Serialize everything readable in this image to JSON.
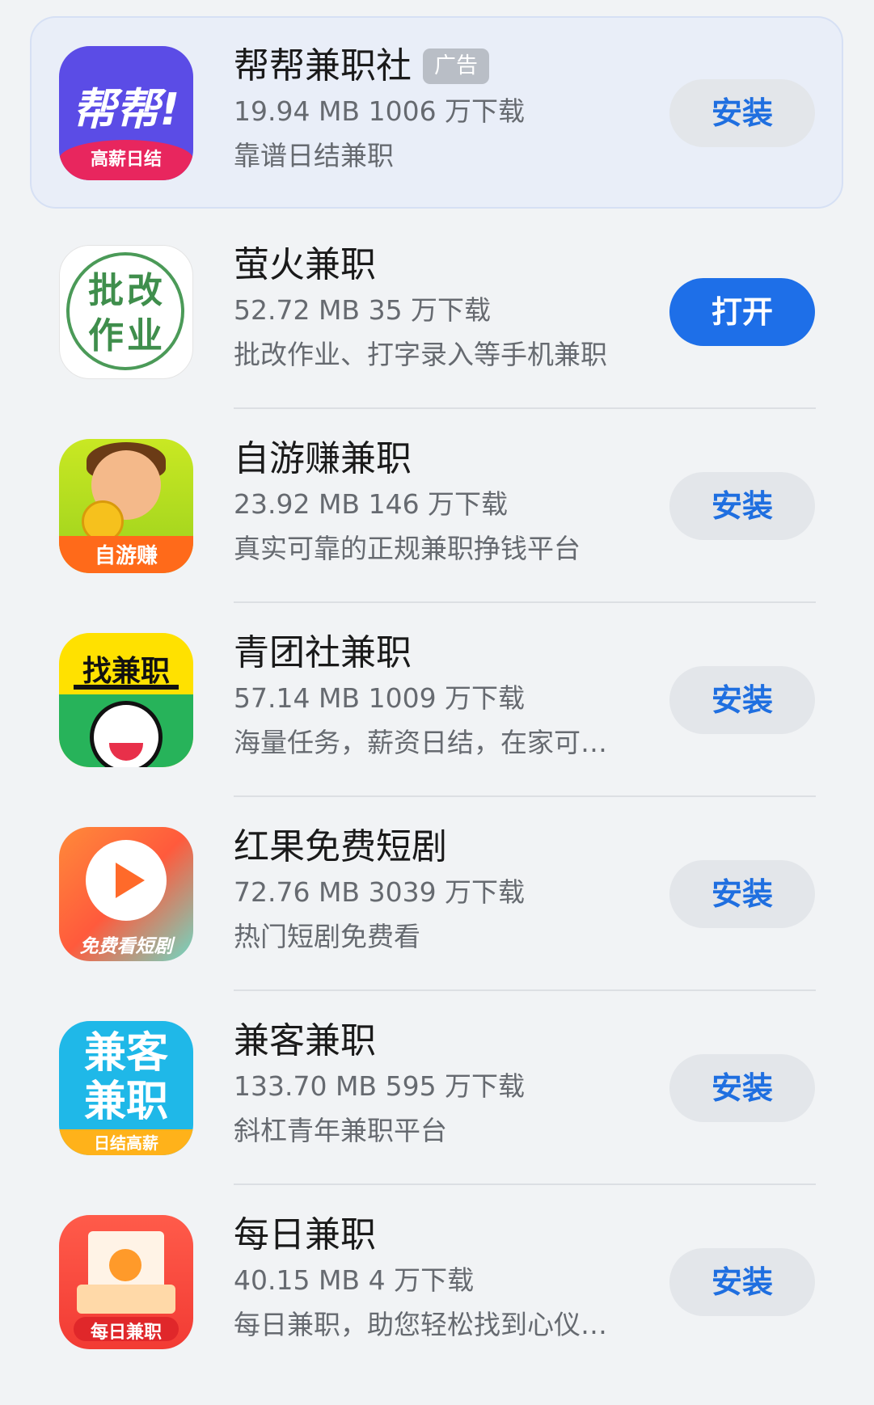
{
  "apps": [
    {
      "name": "帮帮兼职社",
      "ad_label": "广告",
      "size": "19.94 MB",
      "downloads": "1006 万下载",
      "desc": "靠谱日结兼职",
      "button": "安装",
      "button_type": "install",
      "icon": "bangbang-app-icon",
      "icon_text": [
        "帮帮!",
        "高薪日结"
      ]
    },
    {
      "name": "萤火兼职",
      "size": "52.72 MB",
      "downloads": "35 万下载",
      "desc": "批改作业、打字录入等手机兼职",
      "button": "打开",
      "button_type": "open",
      "icon": "pigai-app-icon",
      "icon_text": [
        "批改",
        "作业"
      ]
    },
    {
      "name": "自游赚兼职",
      "size": "23.92 MB",
      "downloads": "146 万下载",
      "desc": "真实可靠的正规兼职挣钱平台",
      "button": "安装",
      "button_type": "install",
      "icon": "ziyouzhuan-app-icon",
      "icon_text": [
        "自游赚"
      ]
    },
    {
      "name": "青团社兼职",
      "size": "57.14 MB",
      "downloads": "1009 万下载",
      "desc": "海量任务，薪资日结，在家可…",
      "button": "安装",
      "button_type": "install",
      "icon": "qingtuanshe-app-icon",
      "icon_text": [
        "找兼职"
      ]
    },
    {
      "name": "红果免费短剧",
      "size": "72.76 MB",
      "downloads": "3039 万下载",
      "desc": "热门短剧免费看",
      "button": "安装",
      "button_type": "install",
      "icon": "hongguo-app-icon",
      "icon_text": [
        "免费看短剧"
      ]
    },
    {
      "name": "兼客兼职",
      "size": "133.70 MB",
      "downloads": "595 万下载",
      "desc": "斜杠青年兼职平台",
      "button": "安装",
      "button_type": "install",
      "icon": "jianke-app-icon",
      "icon_text": [
        "兼客",
        "兼职",
        "日结高薪"
      ]
    },
    {
      "name": "每日兼职",
      "size": "40.15 MB",
      "downloads": "4 万下载",
      "desc": "每日兼职，助您轻松找到心仪…",
      "button": "安装",
      "button_type": "install",
      "icon": "meiri-app-icon",
      "icon_text": [
        "每日兼职"
      ]
    }
  ],
  "colors": {
    "accent": "#1e6fe8",
    "install_bg": "#e3e6ea",
    "install_text": "#1f6fe0",
    "ad_card_bg": "#e9eef8",
    "page_bg": "#f1f3f5"
  }
}
